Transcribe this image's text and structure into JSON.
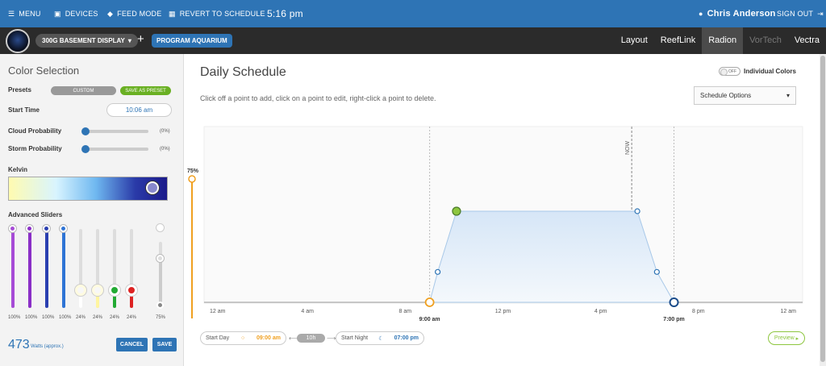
{
  "topbar": {
    "menu": "MENU",
    "devices": "DEVICES",
    "feed_mode": "FEED MODE",
    "revert": "REVERT TO SCHEDULE",
    "time": "5:16 pm",
    "user": "Chris Anderson",
    "sign_out": "SIGN OUT",
    "accent": "#2e74b5"
  },
  "subbar": {
    "device": "300G BASEMENT DISPLAY",
    "program": "PROGRAM AQUARIUM",
    "tabs": [
      "Layout",
      "ReefLink",
      "Radion",
      "VorTech",
      "Vectra"
    ],
    "active_tab": "Radion"
  },
  "left": {
    "title": "Color Selection",
    "presets_label": "Presets",
    "preset_value": "CUSTOM",
    "save_preset": "SAVE AS PRESET",
    "start_time_label": "Start Time",
    "start_time": "10:06 am",
    "cloud_label": "Cloud Probability",
    "cloud_value": "(0%)",
    "storm_label": "Storm Probability",
    "storm_value": "(0%)",
    "kelvin_label": "Kelvin",
    "advanced_label": "Advanced Sliders",
    "sliders": [
      {
        "value": "100%",
        "color": "#a64bd6",
        "level": 1.0
      },
      {
        "value": "100%",
        "color": "#8a2fc7",
        "level": 1.0
      },
      {
        "value": "100%",
        "color": "#2a3fb0",
        "level": 1.0
      },
      {
        "value": "100%",
        "color": "#2e74d5",
        "level": 1.0
      },
      {
        "value": "24%",
        "color": "#ffffff",
        "level": 0.24
      },
      {
        "value": "24%",
        "color": "#fff5a0",
        "level": 0.24
      },
      {
        "value": "24%",
        "color": "#22aa33",
        "level": 0.24
      },
      {
        "value": "24%",
        "color": "#dd2222",
        "level": 0.24
      },
      {
        "value": "75%",
        "color": "#999999",
        "level": 0.75
      }
    ],
    "watts": "473",
    "watts_label": "Watts (approx.)",
    "cancel": "CANCEL",
    "save": "SAVE"
  },
  "main": {
    "title": "Daily Schedule",
    "hint": "Click off a point to add, click on a point to edit, right-click a point to delete.",
    "individual_colors_toggle": "OFF",
    "individual_colors": "Individual Colors",
    "schedule_options": "Schedule Options",
    "start_day_label": "Start Day",
    "start_day": "09:00 am",
    "duration": "10h",
    "start_night_label": "Start Night",
    "start_night": "07:00 pm",
    "preview": "Preview"
  },
  "chart_data": {
    "type": "area",
    "x_ticks": [
      "12 am",
      "4 am",
      "8 am",
      "12 pm",
      "4 pm",
      "8 pm",
      "12 am"
    ],
    "x_ticks_hours": [
      0,
      4,
      8,
      12,
      16,
      20,
      24
    ],
    "y_label": "75%",
    "y_max": 75,
    "points": [
      {
        "hour": 9.0,
        "value": 0
      },
      {
        "hour": 9.33,
        "value": 25
      },
      {
        "hour": 10.1,
        "value": 75
      },
      {
        "hour": 17.5,
        "value": 75
      },
      {
        "hour": 18.3,
        "value": 25
      },
      {
        "hour": 19.0,
        "value": 0
      }
    ],
    "markers": [
      {
        "hour": 9.0,
        "label": "9:00 am"
      },
      {
        "hour": 19.0,
        "label": "7:00 pm"
      }
    ],
    "now_hour": 17.27,
    "now_label": "NOW"
  }
}
